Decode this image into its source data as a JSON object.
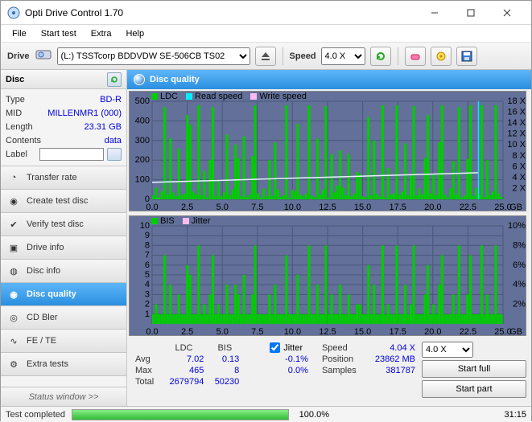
{
  "window": {
    "title": "Opti Drive Control 1.70"
  },
  "menu": {
    "file": "File",
    "start": "Start test",
    "extra": "Extra",
    "help": "Help"
  },
  "toolbar": {
    "drive_label": "Drive",
    "drive_value": "(L:)  TSSTcorp BDDVDW SE-506CB TS02",
    "speed_label": "Speed",
    "speed_value": "4.0 X"
  },
  "disc": {
    "header": "Disc",
    "type_k": "Type",
    "type_v": "BD-R",
    "mid_k": "MID",
    "mid_v": "MILLENMR1 (000)",
    "length_k": "Length",
    "length_v": "23.31 GB",
    "contents_k": "Contents",
    "contents_v": "data",
    "label_k": "Label",
    "label_v": ""
  },
  "nav": {
    "transfer": "Transfer rate",
    "create": "Create test disc",
    "verify": "Verify test disc",
    "driveinfo": "Drive info",
    "discinfo": "Disc info",
    "quality": "Disc quality",
    "cdbler": "CD Bler",
    "fete": "FE / TE",
    "extra": "Extra tests",
    "statuswin": "Status window >>"
  },
  "main": {
    "title": "Disc quality"
  },
  "legend1": {
    "a": "LDC",
    "b": "Read speed",
    "c": "Write speed"
  },
  "legend2": {
    "a": "BIS",
    "b": "Jitter"
  },
  "stats": {
    "ldc_h": "LDC",
    "bis_h": "BIS",
    "avg_l": "Avg",
    "avg_ldc": "7.02",
    "avg_bis": "0.13",
    "max_l": "Max",
    "max_ldc": "465",
    "max_bis": "8",
    "tot_l": "Total",
    "tot_ldc": "2679794",
    "tot_bis": "50230",
    "jitter_l": "Jitter",
    "jitter_avg": "-0.1%",
    "jitter_max": "0.0%",
    "speed_l": "Speed",
    "speed_v": "4.04 X",
    "pos_l": "Position",
    "pos_v": "23862 MB",
    "samp_l": "Samples",
    "samp_v": "381787",
    "speed_sel": "4.0 X",
    "startfull": "Start full",
    "startpart": "Start part"
  },
  "status": {
    "text": "Test completed",
    "pct": "100.0%",
    "time": "31:15",
    "progress": 100
  },
  "chart_data": [
    {
      "type": "bar",
      "title": "LDC",
      "xlabel": "GB",
      "ylabel": "LDC",
      "xlim": [
        0,
        25
      ],
      "ylim": [
        0,
        500
      ],
      "y2lim": [
        0,
        18
      ],
      "x_ticks": [
        0.0,
        2.5,
        5.0,
        7.5,
        10.0,
        12.5,
        15.0,
        17.5,
        20.0,
        22.5,
        25.0
      ],
      "y_ticks": [
        0,
        100,
        200,
        300,
        400,
        500
      ],
      "y2_ticks": [
        "2 X",
        "4 X",
        "6 X",
        "8 X",
        "10 X",
        "12 X",
        "14 X",
        "16 X",
        "18 X"
      ],
      "overlays": [
        {
          "name": "Read speed",
          "color": "#00eaff",
          "type": "line",
          "approx_value": 4.0
        },
        {
          "name": "Write speed",
          "color": "#ffb0e8",
          "type": "line",
          "approx_value": 4.0
        }
      ],
      "series": [
        {
          "name": "LDC",
          "color": "#00cc00",
          "note": "dense per-sample bars; values estimated from pixel heights",
          "samples": [
            20,
            60,
            10,
            40,
            470,
            25,
            310,
            35,
            15,
            260,
            20,
            30,
            430,
            380,
            40,
            25,
            480,
            20,
            145,
            10,
            200,
            470,
            15,
            100,
            15,
            35,
            330,
            22,
            50,
            280,
            210,
            15,
            320,
            12,
            25,
            220,
            480,
            30,
            10,
            55,
            14,
            200,
            18,
            290,
            50,
            12,
            22,
            480,
            10,
            50,
            40,
            385,
            25,
            15,
            30,
            480,
            20,
            10,
            310,
            25,
            50,
            475,
            10,
            230,
            35,
            70,
            250,
            60,
            20,
            230,
            15,
            30,
            140,
            130,
            15,
            10,
            420,
            20,
            300,
            28,
            14,
            480,
            10,
            160,
            25,
            30,
            480,
            25,
            40,
            285,
            20,
            120,
            475,
            20,
            55,
            25,
            210,
            430,
            30,
            130,
            20,
            290,
            480,
            25,
            10,
            55,
            195,
            25,
            470,
            10,
            20,
            205,
            480,
            18,
            60,
            25,
            480,
            12,
            200,
            20,
            40,
            480,
            30,
            12
          ]
        }
      ]
    },
    {
      "type": "bar",
      "title": "BIS",
      "xlabel": "GB",
      "ylabel": "BIS",
      "xlim": [
        0,
        25
      ],
      "ylim": [
        0,
        10
      ],
      "y2lim": [
        0,
        10
      ],
      "x_ticks": [
        0.0,
        2.5,
        5.0,
        7.5,
        10.0,
        12.5,
        15.0,
        17.5,
        20.0,
        22.5,
        25.0
      ],
      "y_ticks": [
        1,
        2,
        3,
        4,
        5,
        6,
        7,
        8,
        9,
        10
      ],
      "y2_ticks": [
        "2%",
        "4%",
        "6%",
        "8%",
        "10%"
      ],
      "overlays": [
        {
          "name": "Jitter",
          "color": "#ffb0e8",
          "type": "marker"
        }
      ],
      "series": [
        {
          "name": "BIS",
          "color": "#00cc00",
          "note": "dense per-sample bars; values estimated from pixel heights",
          "samples": [
            1,
            2,
            1,
            1,
            7,
            1,
            4,
            1,
            1,
            3,
            1,
            1,
            6,
            5,
            1,
            1,
            8,
            1,
            2,
            1,
            3,
            7,
            1,
            2,
            1,
            1,
            4,
            1,
            1,
            4,
            3,
            1,
            5,
            1,
            1,
            3,
            8,
            1,
            1,
            1,
            1,
            3,
            1,
            4,
            1,
            1,
            1,
            7,
            1,
            1,
            1,
            5,
            1,
            1,
            1,
            8,
            1,
            1,
            4,
            1,
            1,
            8,
            1,
            3,
            1,
            1,
            4,
            1,
            1,
            3,
            1,
            1,
            2,
            2,
            1,
            1,
            6,
            1,
            4,
            1,
            1,
            8,
            1,
            2,
            1,
            1,
            8,
            1,
            1,
            4,
            1,
            2,
            8,
            1,
            1,
            1,
            3,
            6,
            1,
            2,
            1,
            4,
            7,
            1,
            1,
            1,
            3,
            1,
            8,
            1,
            1,
            3,
            7,
            1,
            1,
            1,
            8,
            1,
            3,
            1,
            1,
            8,
            1,
            1
          ]
        }
      ]
    }
  ]
}
